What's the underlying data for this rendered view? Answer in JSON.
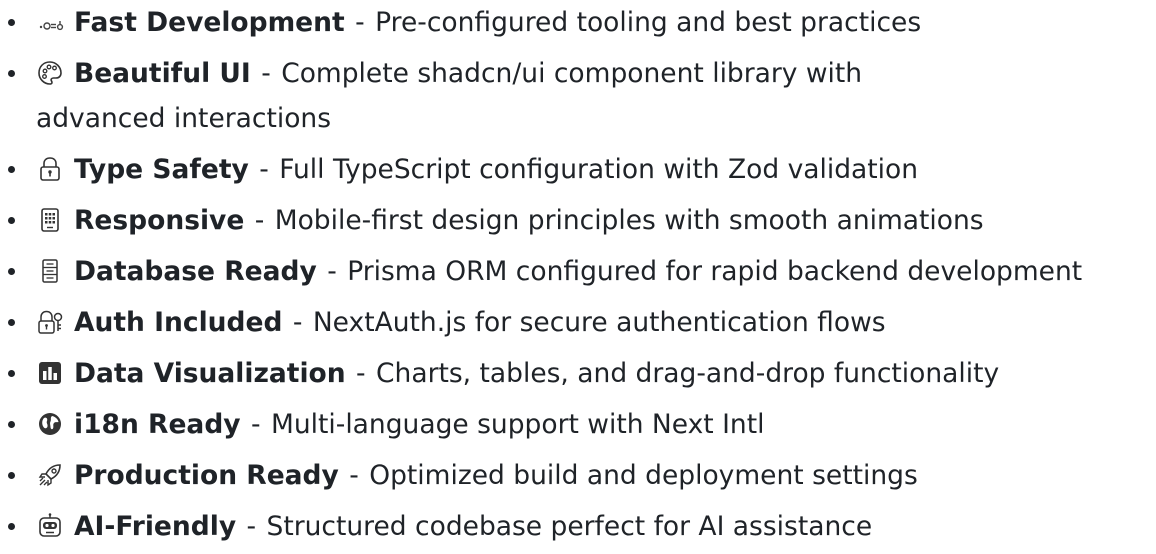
{
  "features": [
    {
      "icon": "gears-icon",
      "title": "Fast Development",
      "separator": " - ",
      "description": "Pre-configured tooling and best practices"
    },
    {
      "icon": "palette-icon",
      "title": "Beautiful UI",
      "separator": " - ",
      "description": "Complete shadcn/ui component library with advanced interactions"
    },
    {
      "icon": "lock-icon",
      "title": "Type Safety",
      "separator": " - ",
      "description": "Full TypeScript configuration with Zod validation"
    },
    {
      "icon": "mobile-icon",
      "title": "Responsive",
      "separator": " - ",
      "description": "Mobile-first design principles with smooth animations"
    },
    {
      "icon": "database-icon",
      "title": "Database Ready",
      "separator": " - ",
      "description": "Prisma ORM configured for rapid backend development"
    },
    {
      "icon": "key-lock-icon",
      "title": "Auth Included",
      "separator": " - ",
      "description": "NextAuth.js for secure authentication flows"
    },
    {
      "icon": "bar-chart-icon",
      "title": "Data Visualization",
      "separator": " - ",
      "description": "Charts, tables, and drag-and-drop functionality"
    },
    {
      "icon": "globe-icon",
      "title": "i18n Ready",
      "separator": " - ",
      "description": "Multi-language support with Next Intl"
    },
    {
      "icon": "rocket-icon",
      "title": "Production Ready",
      "separator": " - ",
      "description": "Optimized build and deployment settings"
    },
    {
      "icon": "robot-icon",
      "title": "AI-Friendly",
      "separator": " - ",
      "description": "Structured codebase perfect for AI assistance"
    }
  ]
}
